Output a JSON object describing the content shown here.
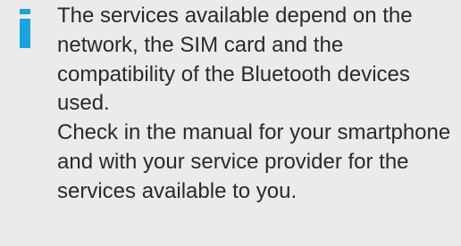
{
  "note": {
    "icon": "info-icon",
    "accent_color": "#1aa3e0",
    "paragraphs": [
      "The services available depend on the network, the SIM card and the compatibility of the Bluetooth devices used.",
      "Check in the manual for your smartphone and with your service provider for the services available to you."
    ]
  }
}
